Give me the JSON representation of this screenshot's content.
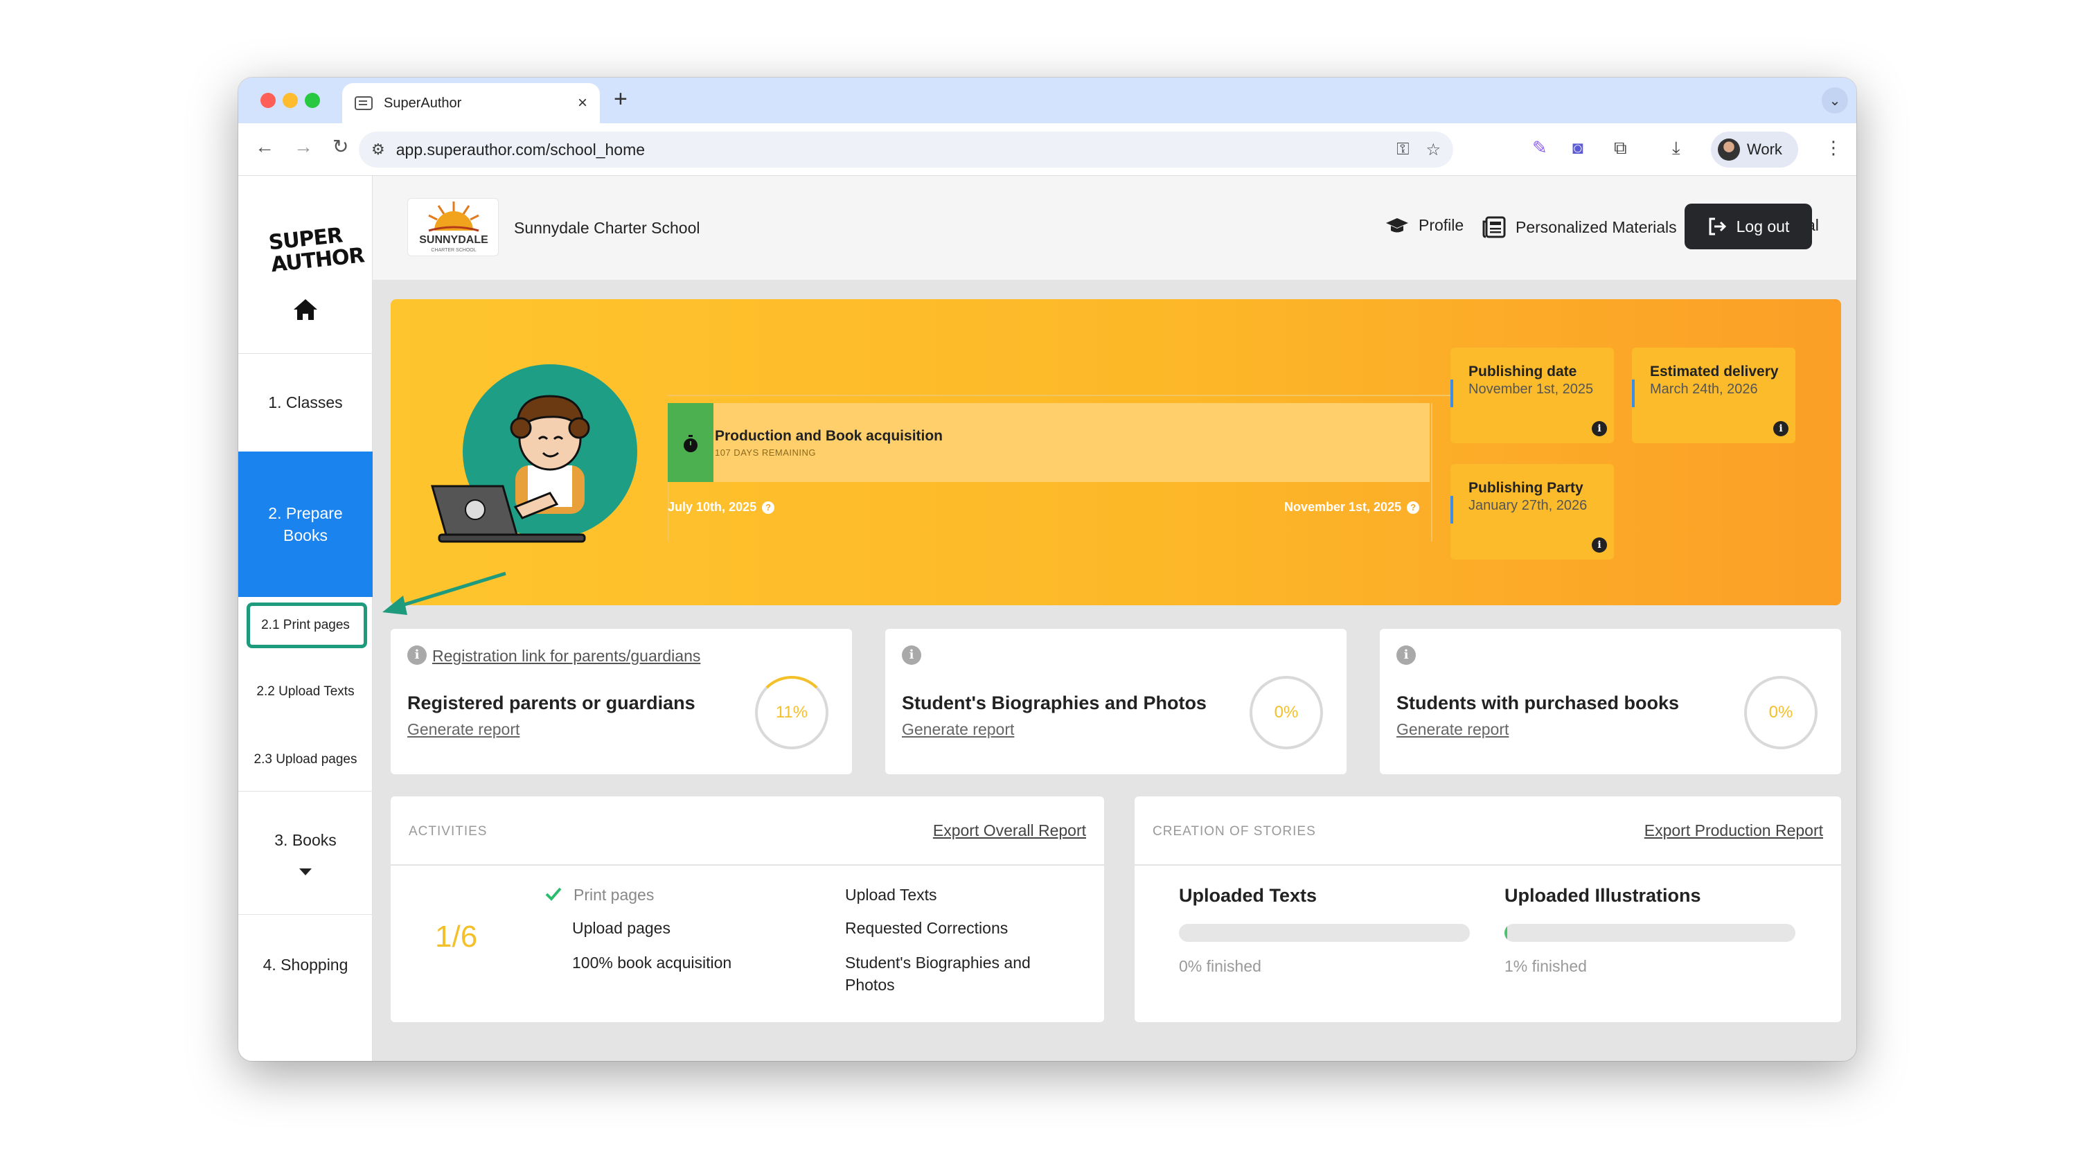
{
  "browser": {
    "tab_title": "SuperAuthor",
    "url": "app.superauthor.com/school_home",
    "profile_label": "Work",
    "accent": "#d3e3fd"
  },
  "sidebar": {
    "logo_text": "SUPER AUTHOR",
    "items": [
      {
        "label": "1. Classes"
      },
      {
        "label": "2. Prepare Books"
      },
      {
        "label": "3. Books"
      },
      {
        "label": "4. Shopping"
      }
    ],
    "sub_items": [
      {
        "label": "2.1 Print pages"
      },
      {
        "label": "2.2 Upload Texts"
      },
      {
        "label": "2.3 Upload pages"
      }
    ],
    "active_color": "#1a83ee",
    "highlight_color": "#1e9a7d"
  },
  "header": {
    "school_logo_text": "SUNNYDALE",
    "school_logo_subtext": "CHARTER SCHOOL",
    "school_name": "Sunnydale Charter School",
    "nav": [
      {
        "label": "Profile",
        "icon": "graduation-cap-icon"
      },
      {
        "label": "Personalized Materials",
        "icon": "newspaper-icon"
      },
      {
        "label": "Pedagogical Resources",
        "icon": "teacher-board-icon"
      }
    ],
    "logout_label": "Log out"
  },
  "banner": {
    "timeline": {
      "title": "Production and Book acquisition",
      "remaining": "107 DAYS REMAINING",
      "progress_fraction": 0.06,
      "start_date": "July 10th, 2025",
      "end_date": "November 1st, 2025"
    },
    "cards": [
      {
        "title": "Publishing date",
        "value": "November 1st, 2025"
      },
      {
        "title": "Estimated delivery",
        "value": "March 24th, 2026"
      },
      {
        "title": "Publishing Party",
        "value": "January 27th, 2026"
      }
    ]
  },
  "stats": [
    {
      "link": "Registration link for parents/guardians",
      "title": "Registered parents or guardians",
      "report": "Generate report",
      "value": "11%"
    },
    {
      "link": "",
      "title": "Student's Biographies and Photos",
      "report": "Generate report",
      "value": "0%"
    },
    {
      "link": "",
      "title": "Students with purchased books",
      "report": "Generate report",
      "value": "0%"
    }
  ],
  "activities": {
    "label": "ACTIVITIES",
    "export": "Export Overall Report",
    "fraction": "1/6",
    "items": [
      {
        "label": "Print pages",
        "done": true
      },
      {
        "label": "Upload Texts",
        "done": false
      },
      {
        "label": "Upload pages",
        "done": false
      },
      {
        "label": "Requested Corrections",
        "done": false
      },
      {
        "label": "100% book acquisition",
        "done": false
      },
      {
        "label": "Student's Biographies and Photos",
        "done": false
      }
    ]
  },
  "stories": {
    "label": "CREATION OF STORIES",
    "export": "Export Production Report",
    "texts": {
      "title": "Uploaded Texts",
      "percent": 0,
      "caption": "0% finished"
    },
    "illustrations": {
      "title": "Uploaded Illustrations",
      "percent": 1,
      "caption": "1% finished"
    }
  }
}
